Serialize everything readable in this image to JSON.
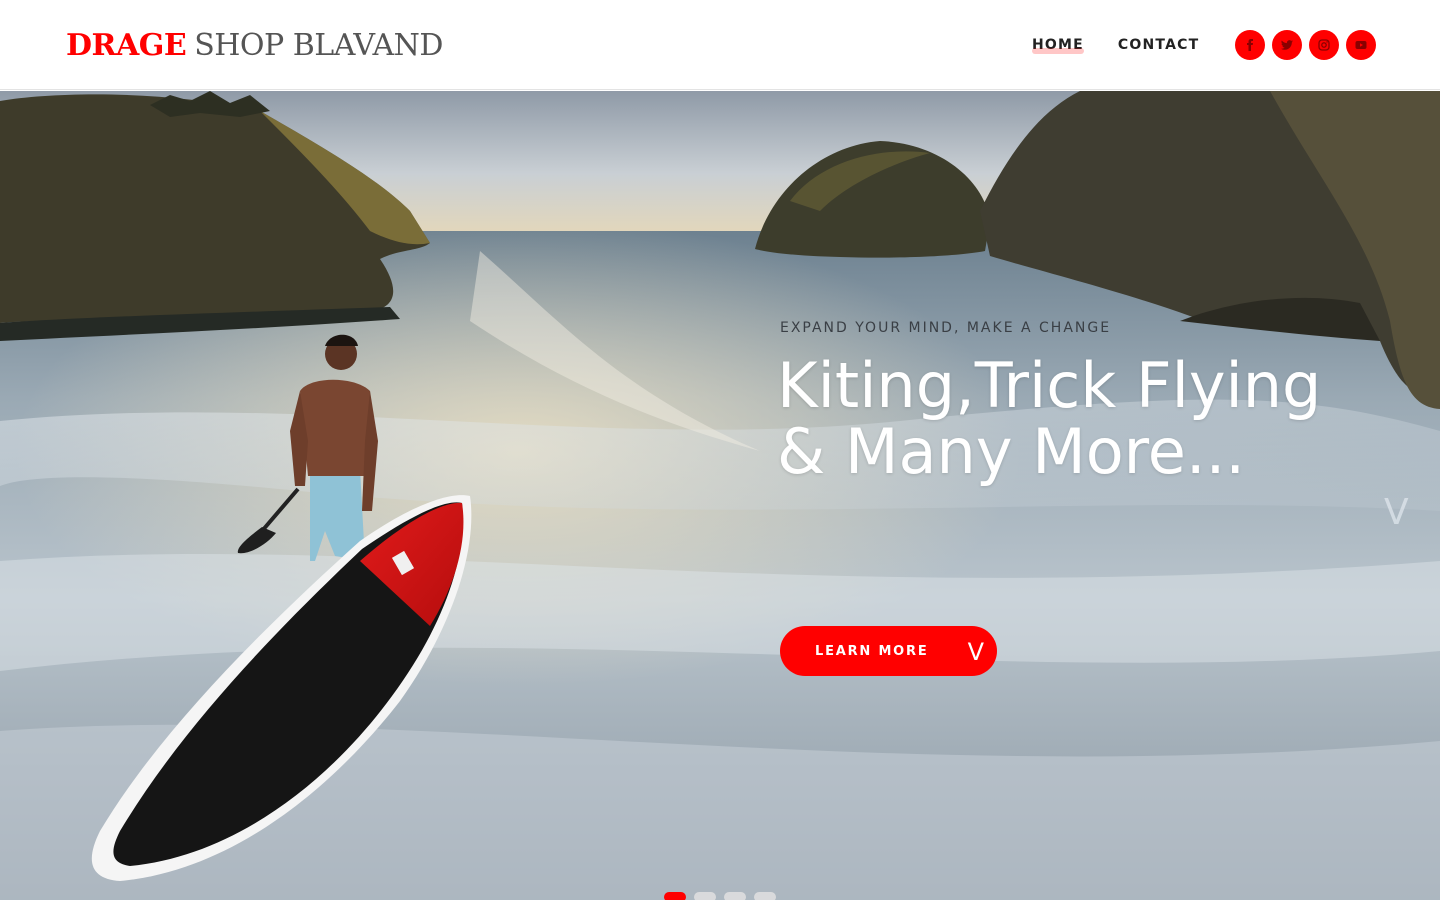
{
  "brand": {
    "name_strong": "DRAGE",
    "name_light": "SHOP BLAVAND"
  },
  "nav": [
    {
      "label": "HOME",
      "active": true
    },
    {
      "label": "CONTACT",
      "active": false
    }
  ],
  "socials": [
    {
      "icon": "facebook-icon"
    },
    {
      "icon": "twitter-icon"
    },
    {
      "icon": "instagram-icon"
    },
    {
      "icon": "youtube-icon"
    }
  ],
  "hero": {
    "subtitle": "EXPAND YOUR MIND, MAKE A CHANGE",
    "title_line1": "Kiting,Trick Flying",
    "title_line2": "& Many More...",
    "cta_label": "LEARN MORE",
    "cta_icon": "V",
    "next_arrow": "V",
    "slides_total": 4,
    "slide_active": 1
  },
  "colors": {
    "accent": "#ff0000",
    "text_dark": "#222222",
    "logo_grey": "#555555"
  }
}
